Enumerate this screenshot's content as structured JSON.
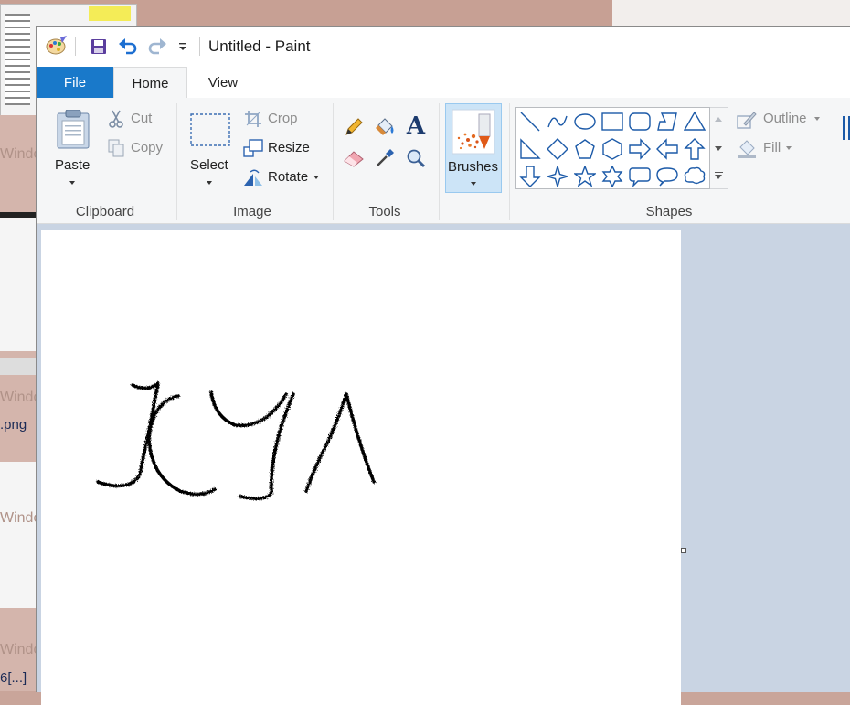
{
  "background": {
    "window_labels": [
      "Windo",
      "Windo",
      "Windo",
      "Windo"
    ],
    "file_labels": [
      ".png",
      "6[...]"
    ]
  },
  "window": {
    "title": "Untitled - Paint",
    "quick_access": [
      "save-icon",
      "undo-icon",
      "redo-icon",
      "customize-dropdown-icon"
    ]
  },
  "tabs": {
    "file": "File",
    "home": "Home",
    "view": "View"
  },
  "ribbon": {
    "clipboard": {
      "label": "Clipboard",
      "paste": "Paste",
      "cut": "Cut",
      "copy": "Copy"
    },
    "image": {
      "label": "Image",
      "select": "Select",
      "crop": "Crop",
      "resize": "Resize",
      "rotate": "Rotate"
    },
    "tools": {
      "label": "Tools",
      "items": [
        "pencil-icon",
        "fill-bucket-icon",
        "text-icon",
        "eraser-icon",
        "color-picker-icon",
        "magnifier-icon"
      ]
    },
    "brushes": {
      "label": "Brushes"
    },
    "shapes": {
      "label": "Shapes",
      "outline": "Outline",
      "fill": "Fill",
      "items": [
        "line",
        "curve",
        "oval",
        "rectangle",
        "rounded-rectangle",
        "polygon",
        "triangle",
        "right-triangle",
        "diamond",
        "pentagon",
        "hexagon",
        "right-arrow",
        "left-arrow",
        "up-arrow",
        "down-arrow",
        "four-point-star",
        "five-point-star",
        "six-point-star",
        "rounded-callout",
        "oval-callout",
        "cloud-callout"
      ]
    }
  },
  "colors": {
    "file_tab": "#1979ca",
    "selected": "#cce4f7",
    "workspace": "#c9d4e3",
    "ink": "#000000"
  }
}
